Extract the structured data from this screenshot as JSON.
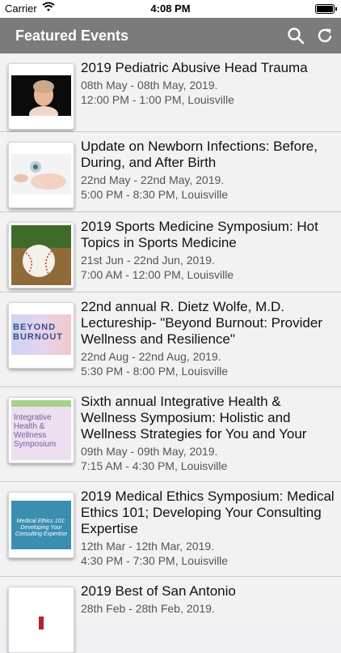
{
  "status": {
    "carrier": "Carrier",
    "time": "4:08 PM"
  },
  "nav": {
    "title": "Featured Events"
  },
  "events": [
    {
      "title": "2019 Pediatric Abusive Head Trauma",
      "dates": "08th May - 08th May, 2019.",
      "time": "12:00 PM - 1:00 PM, Louisville"
    },
    {
      "title": "Update on Newborn Infections: Before, During, and After Birth",
      "dates": "22nd May - 22nd May, 2019.",
      "time": "5:00 PM - 8:30 PM, Louisville"
    },
    {
      "title": "2019 Sports Medicine Symposium: Hot Topics in Sports Medicine",
      "dates": "21st Jun - 22nd Jun, 2019.",
      "time": "7:00 AM - 12:00 PM, Louisville"
    },
    {
      "title": "22nd annual R. Dietz Wolfe, M.D. Lectureship- \"Beyond Burnout: Provider Wellness and Resilience\"",
      "dates": "22nd Aug - 22nd Aug, 2019.",
      "time": "5:30 PM - 8:00 PM, Louisville",
      "thumb_text": "BEYOND BURNOUT"
    },
    {
      "title": "Sixth annual Integrative Health & Wellness Symposium:  Holistic and Wellness Strategies for You and Your",
      "dates": "09th May - 09th May, 2019.",
      "time": "7:15 AM - 4:30 PM, Louisville",
      "thumb_text": "Integrative Health & Wellness Symposium"
    },
    {
      "title": "2019 Medical Ethics Symposium: Medical Ethics 101; Developing Your Consulting Expertise",
      "dates": "12th Mar - 12th Mar, 2019.",
      "time": "4:30 PM - 7:30 PM, Louisville",
      "thumb_text": "Medical Ethics 101: Developing Your Consulting Expertise"
    },
    {
      "title": "2019 Best of San Antonio",
      "dates": "28th Feb - 28th Feb, 2019.",
      "time": ""
    }
  ]
}
